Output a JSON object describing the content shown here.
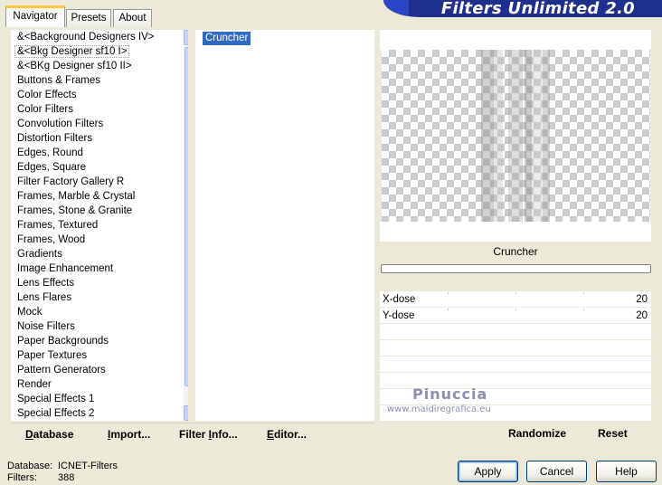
{
  "banner": {
    "title": "Filters Unlimited 2.0"
  },
  "tabs": [
    {
      "label": "Navigator",
      "active": true
    },
    {
      "label": "Presets",
      "active": false
    },
    {
      "label": "About",
      "active": false
    }
  ],
  "categories": [
    "&<Background Designers IV>",
    "&<Bkg Designer sf10 I>",
    "&<BKg Designer sf10 II>",
    "Buttons & Frames",
    "Color Effects",
    "Color Filters",
    "Convolution Filters",
    "Distortion Filters",
    "Edges, Round",
    "Edges, Square",
    "Filter Factory Gallery R",
    "Frames, Marble & Crystal",
    "Frames, Stone & Granite",
    "Frames, Textured",
    "Frames, Wood",
    "Gradients",
    "Image Enhancement",
    "Lens Effects",
    "Lens Flares",
    "Mock",
    "Noise Filters",
    "Paper Backgrounds",
    "Paper Textures",
    "Pattern Generators",
    "Render",
    "Special Effects 1",
    "Special Effects 2"
  ],
  "selected_category_index": 1,
  "filters": [
    "Cruncher"
  ],
  "actions": {
    "database": {
      "u": "D",
      "rest": "atabase"
    },
    "import": {
      "u": "I",
      "rest": "mport..."
    },
    "filter_info": {
      "pre": "Filter ",
      "u": "I",
      "post": "nfo..."
    },
    "editor": {
      "u": "E",
      "rest": "ditor..."
    }
  },
  "preview": {
    "filter_name": "Cruncher"
  },
  "params": [
    {
      "label": "X-dose",
      "value": "20"
    },
    {
      "label": "Y-dose",
      "value": "20"
    }
  ],
  "right_actions": {
    "randomize": "Randomize",
    "reset": "Reset"
  },
  "watermark": {
    "name": "Pinuccia",
    "url": "www.maidiregrafica.eu"
  },
  "status": {
    "database_label": "Database:",
    "database_value": "ICNET-Filters",
    "filters_label": "Filters:",
    "filters_value": "388"
  },
  "buttons": {
    "apply": "Apply",
    "cancel": "Cancel",
    "help": "Help"
  },
  "colors": {
    "banner": "#1f2f8c",
    "selection": "#316ac5",
    "background": "#ece9d8"
  }
}
